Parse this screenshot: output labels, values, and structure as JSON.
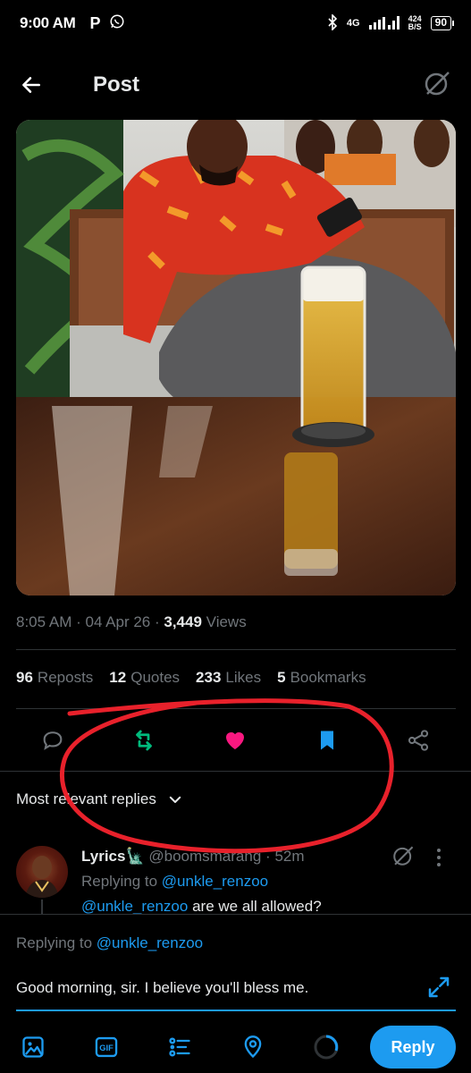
{
  "status_bar": {
    "time": "9:00 AM",
    "network": "4G",
    "speed_value": "424",
    "speed_unit": "B/S",
    "battery": "90",
    "icons": [
      "p-app-icon",
      "whatsapp-icon",
      "bluetooth-icon",
      "signal-icon",
      "battery-icon"
    ]
  },
  "header": {
    "title": "Post",
    "back_icon": "arrow-left-icon",
    "grok_icon": "grok-icon"
  },
  "post": {
    "time": "8:05 AM",
    "date": "04 Apr 26",
    "views_count": "3,449",
    "views_label": "Views",
    "reposts_count": "96",
    "reposts_label": "Reposts",
    "quotes_count": "12",
    "quotes_label": "Quotes",
    "likes_count": "233",
    "likes_label": "Likes",
    "bookmarks_count": "5",
    "bookmarks_label": "Bookmarks"
  },
  "actions": {
    "icons": [
      "reply-icon",
      "repost-icon",
      "like-icon",
      "bookmark-icon",
      "share-icon"
    ],
    "repost_color": "#00ba7c",
    "like_color": "#f91880",
    "bookmark_color": "#1d9bf0"
  },
  "replies_sort": {
    "label": "Most relevant replies"
  },
  "reply": {
    "name": "Lyrics🗽",
    "handle": "@boomsmarang",
    "time": "52m",
    "replying_to_label": "Replying to",
    "replying_to_handle": "@unkle_renzoo",
    "mention": "@unkle_renzoo",
    "text": "are we all allowed?"
  },
  "composer": {
    "replying_to_label": "Replying to",
    "replying_to_handle": "@unkle_renzoo",
    "value": "Good morning, sir. I believe you'll bless me.",
    "reply_button": "Reply",
    "gif_label": "GIF",
    "tools": [
      "image-icon",
      "gif-icon",
      "poll-icon",
      "location-icon",
      "progress-ring-icon"
    ]
  },
  "colors": {
    "accent": "#1d9bf0",
    "annotation": "#e8212b"
  }
}
